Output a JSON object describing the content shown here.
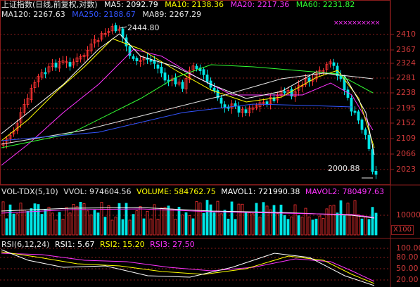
{
  "main_header": {
    "line1": [
      {
        "text": "上证指数(日线,前复权,对数)",
        "color": "#e6e6e6"
      },
      {
        "text": "MA5: 2092.79",
        "color": "#ffffff"
      },
      {
        "text": "MA10: 2138.36",
        "color": "#ffff00"
      },
      {
        "text": "MA20: 2217.36",
        "color": "#ff33ff"
      },
      {
        "text": "MA60: 2231.82",
        "color": "#33ff33"
      }
    ],
    "line2": [
      {
        "text": "MA120: 2267.63",
        "color": "#e6e6e6"
      },
      {
        "text": "MA250: 2188.67",
        "color": "#3355ff"
      },
      {
        "text": "MA89: 2267.29",
        "color": "#e6e6e6"
      }
    ]
  },
  "price_axis_labels": [
    "2410",
    "2367",
    "2324",
    "2281",
    "2238",
    "2195",
    "2152",
    "2109",
    "2066",
    "2023"
  ],
  "annotations": {
    "high": "2444.80",
    "low": "2000.88"
  },
  "volume_header": [
    {
      "text": "VOL-TDX(5,10)",
      "color": "#e6e6e6"
    },
    {
      "text": "VVOL: 974604.56",
      "color": "#e6e6e6"
    },
    {
      "text": "VOLUME: 584762.75",
      "color": "#ffff00"
    },
    {
      "text": "MAVOL1: 721990.38",
      "color": "#ffffff"
    },
    {
      "text": "MAVOL2: 780497.63",
      "color": "#ff33ff"
    }
  ],
  "volume_axis_label": "10000",
  "volume_unit_button": "X100",
  "rsi_header": [
    {
      "text": "RSI(6,12,24)",
      "color": "#e6e6e6"
    },
    {
      "text": "RSI1: 5.67",
      "color": "#ffffff"
    },
    {
      "text": "RSI2: 15.20",
      "color": "#ffff00"
    },
    {
      "text": "RSI3: 27.50",
      "color": "#ff33ff"
    }
  ],
  "rsi_axis_labels": [
    "100.00",
    "80.00",
    "50.00",
    "20.00"
  ],
  "colors": {
    "up": "#ff3232",
    "down": "#00e5e5",
    "grid": "#8a1c1c",
    "axis_text": "#d23a3a"
  }
}
